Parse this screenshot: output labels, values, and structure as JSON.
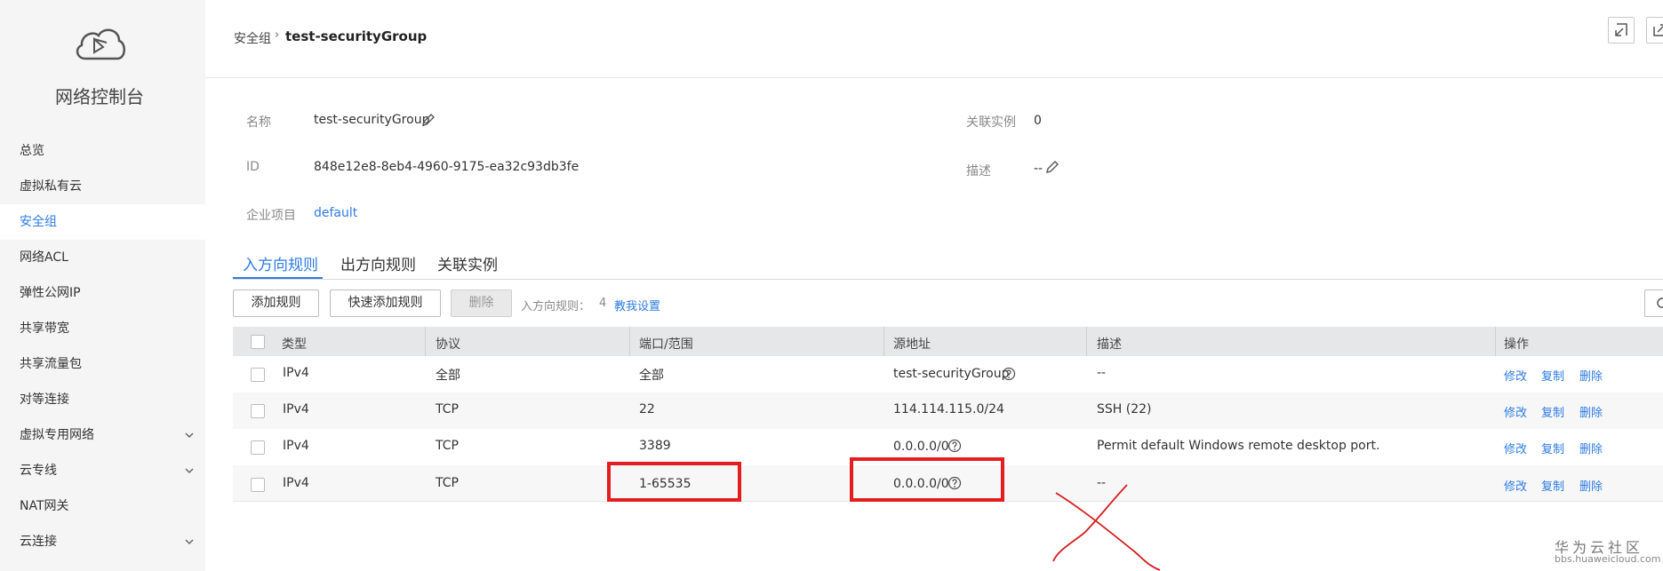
{
  "sidebar": {
    "title": "网络控制台",
    "items": [
      {
        "label": "总览"
      },
      {
        "label": "虚拟私有云"
      },
      {
        "label": "安全组"
      },
      {
        "label": "网络ACL"
      },
      {
        "label": "弹性公网IP"
      },
      {
        "label": "共享带宽"
      },
      {
        "label": "共享流量包"
      },
      {
        "label": "对等连接"
      },
      {
        "label": "虚拟专用网络"
      },
      {
        "label": "云专线"
      },
      {
        "label": "NAT网关"
      },
      {
        "label": "云连接"
      }
    ],
    "active_item": "安全组"
  },
  "header": {
    "breadcrumb_parent": "安全组",
    "breadcrumb_sep": "›",
    "breadcrumb_current": "test-securityGroup"
  },
  "details": {
    "name_label": "名称",
    "name_value": "test-securityGroup",
    "id_label": "ID",
    "id_value": "848e12e8-8eb4-4960-9175-ea32c93db3fe",
    "project_label": "企业项目",
    "project_value": "default",
    "instances_label": "关联实例",
    "instances_value": "0",
    "desc_label": "描述",
    "desc_value": "--"
  },
  "tabs": [
    {
      "label": "入方向规则"
    },
    {
      "label": "出方向规则"
    },
    {
      "label": "关联实例"
    }
  ],
  "toolbar": {
    "add_rule": "添加规则",
    "quick_add_rule": "快速添加规则",
    "delete": "删除",
    "rule_count_label": "入方向规则：",
    "rule_count": "4",
    "help_link": "教我设置"
  },
  "table": {
    "headers": [
      "类型",
      "协议",
      "端口/范围",
      "源地址",
      "描述",
      "操作"
    ],
    "rows": [
      {
        "type": "IPv4",
        "protocol": "全部",
        "port": "全部",
        "source": "test-securityGroup",
        "source_is_link": true,
        "desc": "--"
      },
      {
        "type": "IPv4",
        "protocol": "TCP",
        "port": "22",
        "source": "114.114.115.0/24",
        "source_is_link": false,
        "desc": "SSH (22)"
      },
      {
        "type": "IPv4",
        "protocol": "TCP",
        "port": "3389",
        "source": "0.0.0.0/0",
        "source_is_link": false,
        "desc": "Permit default Windows remote desktop port."
      },
      {
        "type": "IPv4",
        "protocol": "TCP",
        "port": "1-65535",
        "source": "0.0.0.0/0",
        "source_is_link": false,
        "desc": "--"
      }
    ],
    "actions": {
      "edit": "修改",
      "copy": "复制",
      "delete": "删除"
    }
  },
  "watermark": {
    "line1": "华为云社区",
    "line2": "bbs.huaweicloud.com"
  },
  "colors": {
    "accent": "#2d7be5",
    "annotation_red": "#e41e1e"
  },
  "icons": [
    "cloud-logo-icon",
    "chevron-down-icon",
    "edit-pencil-icon",
    "help-circle-icon",
    "refresh-icon",
    "exit-icon"
  ]
}
